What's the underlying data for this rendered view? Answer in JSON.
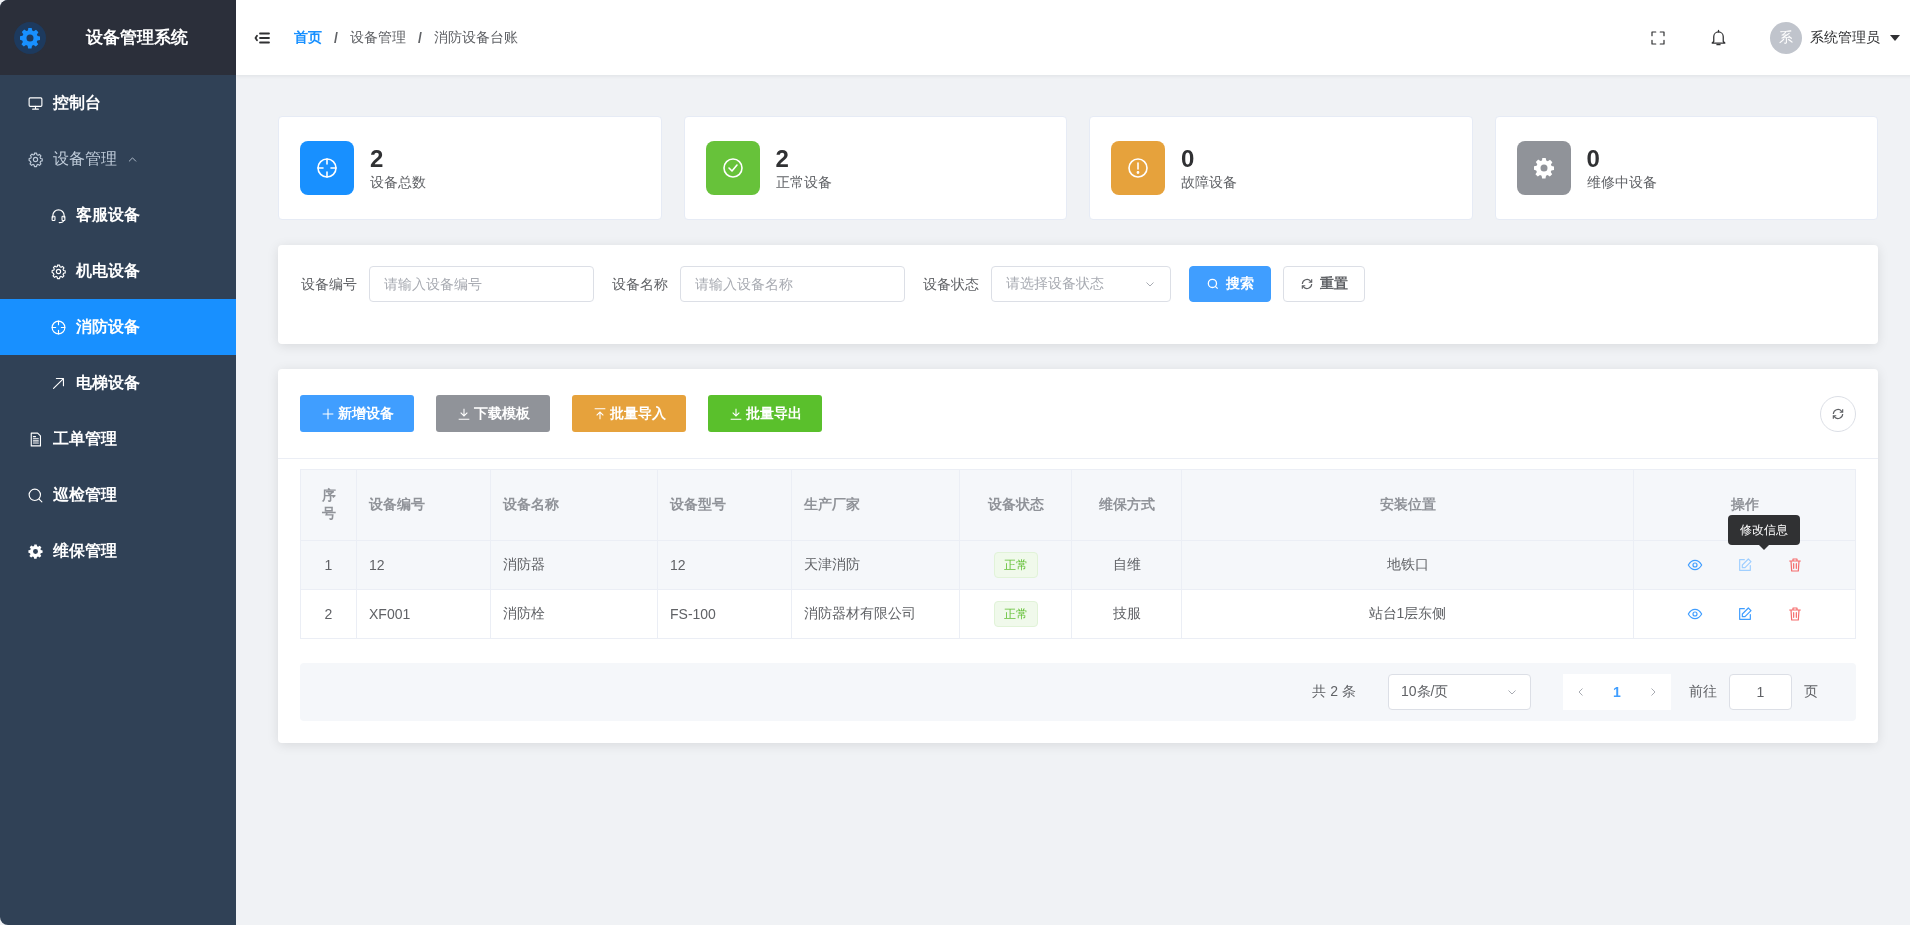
{
  "sidebar": {
    "title": "设备管理系统",
    "items": [
      {
        "label": "控制台",
        "selected": false
      },
      {
        "label": "设备管理",
        "selected": false,
        "expanded": true,
        "children": [
          {
            "label": "客服设备",
            "selected": false
          },
          {
            "label": "机电设备",
            "selected": false
          },
          {
            "label": "消防设备",
            "selected": true
          },
          {
            "label": "电梯设备",
            "selected": false
          }
        ]
      },
      {
        "label": "工单管理",
        "selected": false
      },
      {
        "label": "巡检管理",
        "selected": false
      },
      {
        "label": "维保管理",
        "selected": false
      }
    ]
  },
  "header": {
    "breadcrumb": [
      "首页",
      "设备管理",
      "消防设备台账"
    ],
    "separator": "/",
    "avatar": "系",
    "user": "系统管理员"
  },
  "stats": [
    {
      "value": "2",
      "label": "设备总数",
      "color": "#1890ff"
    },
    {
      "value": "2",
      "label": "正常设备",
      "color": "#67c23a"
    },
    {
      "value": "0",
      "label": "故障设备",
      "color": "#e6a23c"
    },
    {
      "value": "0",
      "label": "维修中设备",
      "color": "#909399"
    }
  ],
  "filter": {
    "fields": [
      {
        "kind": "input",
        "label": "设备编号",
        "placeholder": "请输入设备编号"
      },
      {
        "kind": "input",
        "label": "设备名称",
        "placeholder": "请输入设备名称"
      },
      {
        "kind": "select",
        "label": "设备状态",
        "placeholder": "请选择设备状态"
      }
    ],
    "buttons": [
      {
        "kind": "primary",
        "label": "搜索"
      },
      {
        "kind": "plain",
        "label": "重置"
      }
    ]
  },
  "toolbar": [
    {
      "label": "新增设备",
      "color": "#409eff"
    },
    {
      "label": "下载模板",
      "color": "#909399"
    },
    {
      "label": "批量导入",
      "color": "#e6a23c"
    },
    {
      "label": "批量导出",
      "color": "#5ac02c"
    }
  ],
  "table": {
    "columns": [
      "序号",
      "设备编号",
      "设备名称",
      "设备型号",
      "生产厂家",
      "设备状态",
      "维保方式",
      "安装位置",
      "操作"
    ],
    "rows": [
      {
        "hovered": true,
        "cells": [
          "1",
          "12",
          "消防器",
          "12",
          "天津消防",
          "正常",
          "自维",
          "地铁口"
        ]
      },
      {
        "hovered": false,
        "cells": [
          "2",
          "XF001",
          "消防栓",
          "FS-100",
          "消防器材有限公司",
          "正常",
          "技服",
          "站台1层东侧"
        ]
      }
    ],
    "tooltip": "修改信息"
  },
  "pagination": {
    "total": "共 2 条",
    "page_size": "10条/页",
    "current": "1",
    "goto_label": "前往",
    "goto_value": "1",
    "page_suffix": "页"
  }
}
